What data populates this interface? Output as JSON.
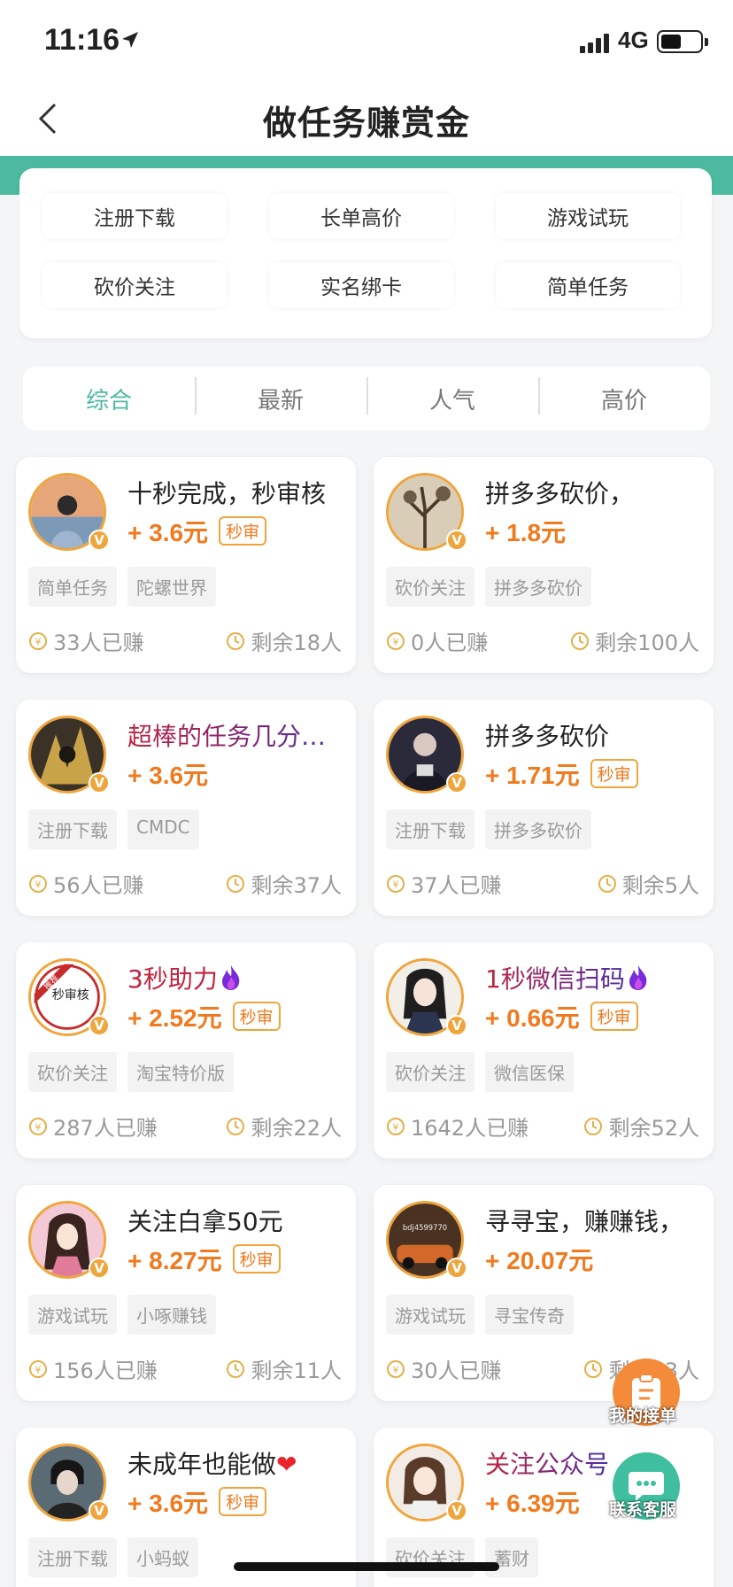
{
  "status": {
    "time": "11:16",
    "network": "4G"
  },
  "nav": {
    "title": "做任务赚赏金"
  },
  "categories": [
    "注册下载",
    "长单高价",
    "游戏试玩",
    "砍价关注",
    "实名绑卡",
    "简单任务"
  ],
  "sort_tabs": [
    "综合",
    "最新",
    "人气",
    "高价"
  ],
  "fast_label": "秒审",
  "cards": [
    {
      "title": "十秒完成，秒审核",
      "price": "+ 3.6元",
      "fast": true,
      "tags": [
        "简单任务",
        "陀螺世界"
      ],
      "earned": "33人已赚",
      "remaining": "剩余18人"
    },
    {
      "title": "拼多多砍价，",
      "price": "+ 1.8元",
      "fast": false,
      "tags": [
        "砍价关注",
        "拼多多砍价"
      ],
      "earned": "0人已赚",
      "remaining": "剩余100人"
    },
    {
      "title": "超棒的任务几分钟完成",
      "price": "+ 3.6元",
      "fast": false,
      "tags": [
        "注册下载",
        "CMDC"
      ],
      "earned": "56人已赚",
      "remaining": "剩余37人"
    },
    {
      "title": "拼多多砍价",
      "price": "+ 1.71元",
      "fast": true,
      "tags": [
        "注册下载",
        "拼多多砍价"
      ],
      "earned": "37人已赚",
      "remaining": "剩余5人"
    },
    {
      "title": "3秒助力",
      "price": "+ 2.52元",
      "fast": true,
      "tags": [
        "砍价关注",
        "淘宝特价版"
      ],
      "earned": "287人已赚",
      "remaining": "剩余22人"
    },
    {
      "title": "1秒微信扫码",
      "price": "+ 0.66元",
      "fast": true,
      "tags": [
        "砍价关注",
        "微信医保"
      ],
      "earned": "1642人已赚",
      "remaining": "剩余52人"
    },
    {
      "title": "关注白拿50元",
      "price": "+ 8.27元",
      "fast": true,
      "tags": [
        "游戏试玩",
        "小啄赚钱"
      ],
      "earned": "156人已赚",
      "remaining": "剩余11人"
    },
    {
      "title": "寻寻宝，赚赚钱，",
      "price": "+ 20.07元",
      "fast": false,
      "tags": [
        "游戏试玩",
        "寻宝传奇"
      ],
      "earned": "30人已赚",
      "remaining": "剩余13人"
    },
    {
      "title": "未成年也能做",
      "price": "+ 3.6元",
      "fast": true,
      "tags": [
        "注册下载",
        "小蚂蚁"
      ],
      "earned": "",
      "remaining": ""
    },
    {
      "title": "关注公众号",
      "price": "+ 6.39元",
      "fast": false,
      "tags": [
        "砍价关注",
        "蓄财"
      ],
      "earned": "",
      "remaining": ""
    }
  ],
  "avatar_texts": {
    "badge_top": "推荐",
    "stamp": "秒审核",
    "plate": "bdj4599770"
  },
  "floating": {
    "my_orders": "我的接单",
    "contact_service": "联系客服"
  },
  "colors": {
    "accent_green": "#4db9a0",
    "price_orange": "#f07a1e",
    "avatar_ring": "#f0a53c"
  }
}
